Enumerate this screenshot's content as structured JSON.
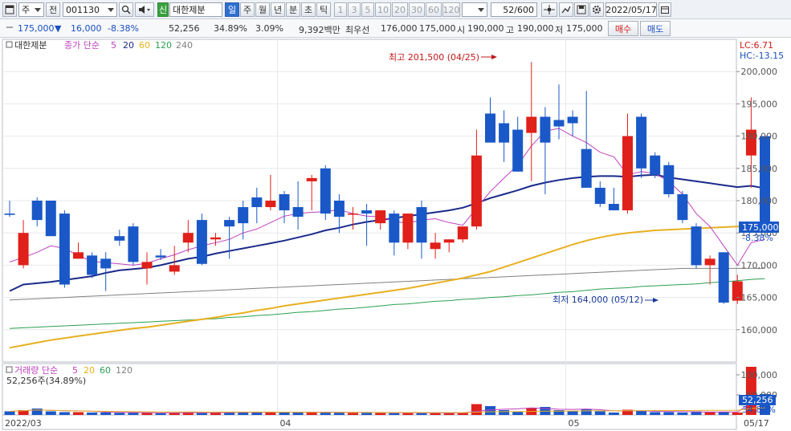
{
  "toolbar": {
    "type_select": "주",
    "prev_label": "전",
    "code": "001130",
    "market_badge": "신",
    "stock_name": "대한제분",
    "period_tabs": [
      "일",
      "주",
      "월",
      "년",
      "분",
      "초",
      "틱"
    ],
    "active_period": "일",
    "intervals": [
      "1",
      "3",
      "5",
      "10",
      "20",
      "30",
      "60",
      "120"
    ],
    "count": "52/600",
    "date": "2022/05/17"
  },
  "quote": {
    "price": "175,000",
    "change": "16,000",
    "change_pct": "-8.38%",
    "volume": "52,256",
    "vol_ratio": "34.89%",
    "turnover": "3.09%",
    "amount": "9,392백만",
    "best_ask_label": "최우선",
    "best_ask": "176,000",
    "best_bid": "175,000",
    "open_label": "시",
    "open": "190,000",
    "high_label": "고",
    "high": "190,000",
    "low_label": "저",
    "low": "175,000",
    "buy_label": "매수",
    "sell_label": "매도"
  },
  "legend": {
    "name": "대한제분",
    "ma_title": "종가 단순",
    "ma_periods": [
      "5",
      "20",
      "60",
      "120",
      "240"
    ],
    "ma_colors": [
      "#c040c0",
      "#1a2a8a",
      "#e8b020",
      "#2aa050",
      "#808080"
    ],
    "lc": "LC:6.71",
    "hc": "HC:-13.15"
  },
  "annotations": {
    "high_text": "최고 201,500 (04/25)",
    "low_text": "최저 164,000 (05/12)"
  },
  "price_axis": {
    "ticks": [
      "200,000",
      "195,000",
      "190,000",
      "185,000",
      "180,000",
      "175,000",
      "170,000",
      "165,000",
      "160,000"
    ],
    "current_label": "175,000",
    "current_change": "-8.38%"
  },
  "volume_panel": {
    "title": "거래량 단순",
    "ma_periods": [
      "5",
      "20",
      "60",
      "120"
    ],
    "ma_colors": [
      "#c040c0",
      "#e8b020",
      "#2aa050",
      "#808080"
    ],
    "current_text": "52,256주(34.89%)",
    "ticks": [
      "100,000",
      "50,000"
    ],
    "current_label": "52,256",
    "current_pct": "34.89%"
  },
  "date_axis": [
    "2022/03",
    "04",
    "05",
    "05/17"
  ],
  "colors": {
    "up": "#e0201a",
    "down": "#1a58c8",
    "ma5": "#c040c0",
    "ma20": "#1a2a8a",
    "ma60": "#e8b020",
    "ma120": "#2aa050",
    "ma240": "#808080"
  },
  "chart_data": {
    "type": "candlestick",
    "ylim": [
      155000,
      205000
    ],
    "vol_ylim": [
      0,
      120000
    ],
    "candles": [
      {
        "d": "03/01",
        "o": 178000,
        "h": 180000,
        "l": 177500,
        "c": 177800,
        "v": 9000
      },
      {
        "d": "03/02",
        "o": 170000,
        "h": 177000,
        "l": 169500,
        "c": 175000,
        "v": 12000
      },
      {
        "d": "03/03",
        "o": 180000,
        "h": 180500,
        "l": 176000,
        "c": 177000,
        "v": 16000
      },
      {
        "d": "03/04",
        "o": 180000,
        "h": 180000,
        "l": 176000,
        "c": 174500,
        "v": 9000
      },
      {
        "d": "03/07",
        "o": 178000,
        "h": 178500,
        "l": 166500,
        "c": 167000,
        "v": 7000
      },
      {
        "d": "03/08",
        "o": 171000,
        "h": 173500,
        "l": 171000,
        "c": 172000,
        "v": 7000
      },
      {
        "d": "03/10",
        "o": 171500,
        "h": 172000,
        "l": 168000,
        "c": 168500,
        "v": 6000
      },
      {
        "d": "03/11",
        "o": 171000,
        "h": 172000,
        "l": 166000,
        "c": 169500,
        "v": 6000
      },
      {
        "d": "03/14",
        "o": 174500,
        "h": 175500,
        "l": 173000,
        "c": 173800,
        "v": 5000
      },
      {
        "d": "03/15",
        "o": 176000,
        "h": 176500,
        "l": 170000,
        "c": 170500,
        "v": 6000
      },
      {
        "d": "03/16",
        "o": 169500,
        "h": 172000,
        "l": 167000,
        "c": 170500,
        "v": 5000
      },
      {
        "d": "03/17",
        "o": 171500,
        "h": 172500,
        "l": 170800,
        "c": 171200,
        "v": 4000
      },
      {
        "d": "03/18",
        "o": 169000,
        "h": 173000,
        "l": 168500,
        "c": 170000,
        "v": 5000
      },
      {
        "d": "03/21",
        "o": 173500,
        "h": 177000,
        "l": 172000,
        "c": 175000,
        "v": 8000
      },
      {
        "d": "03/22",
        "o": 177000,
        "h": 178000,
        "l": 170000,
        "c": 170200,
        "v": 6000
      },
      {
        "d": "03/23",
        "o": 174000,
        "h": 175000,
        "l": 173000,
        "c": 174300,
        "v": 5000
      },
      {
        "d": "03/24",
        "o": 177000,
        "h": 177500,
        "l": 171000,
        "c": 176000,
        "v": 6000
      },
      {
        "d": "03/25",
        "o": 179000,
        "h": 180000,
        "l": 174000,
        "c": 176500,
        "v": 7000
      },
      {
        "d": "03/28",
        "o": 180500,
        "h": 182000,
        "l": 176500,
        "c": 179000,
        "v": 8000
      },
      {
        "d": "03/29",
        "o": 179000,
        "h": 184000,
        "l": 178500,
        "c": 180000,
        "v": 7000
      },
      {
        "d": "03/30",
        "o": 181000,
        "h": 181500,
        "l": 176500,
        "c": 178500,
        "v": 6000
      },
      {
        "d": "03/31",
        "o": 179000,
        "h": 183000,
        "l": 175500,
        "c": 177500,
        "v": 6000
      },
      {
        "d": "04/01",
        "o": 183000,
        "h": 184000,
        "l": 178500,
        "c": 183500,
        "v": 8000
      },
      {
        "d": "04/04",
        "o": 185000,
        "h": 185500,
        "l": 177000,
        "c": 178000,
        "v": 8000
      },
      {
        "d": "04/05",
        "o": 180000,
        "h": 181000,
        "l": 175000,
        "c": 177500,
        "v": 6000
      },
      {
        "d": "04/06",
        "o": 178000,
        "h": 179000,
        "l": 175500,
        "c": 178000,
        "v": 5000
      },
      {
        "d": "04/07",
        "o": 178500,
        "h": 179500,
        "l": 173000,
        "c": 178000,
        "v": 5000
      },
      {
        "d": "04/08",
        "o": 176500,
        "h": 178500,
        "l": 175500,
        "c": 178500,
        "v": 5000
      },
      {
        "d": "04/11",
        "o": 178000,
        "h": 178500,
        "l": 171500,
        "c": 173500,
        "v": 5000
      },
      {
        "d": "04/12",
        "o": 173500,
        "h": 177500,
        "l": 172500,
        "c": 178000,
        "v": 6000
      },
      {
        "d": "04/13",
        "o": 179000,
        "h": 180000,
        "l": 171000,
        "c": 173500,
        "v": 5000
      },
      {
        "d": "04/14",
        "o": 172500,
        "h": 175000,
        "l": 171000,
        "c": 173500,
        "v": 4000
      },
      {
        "d": "04/15",
        "o": 173500,
        "h": 174000,
        "l": 172000,
        "c": 174000,
        "v": 4000
      },
      {
        "d": "04/18",
        "o": 174000,
        "h": 176000,
        "l": 173500,
        "c": 176000,
        "v": 6000
      },
      {
        "d": "04/19",
        "o": 176000,
        "h": 191000,
        "l": 175500,
        "c": 187000,
        "v": 27000
      },
      {
        "d": "04/20",
        "o": 193500,
        "h": 196000,
        "l": 189000,
        "c": 189000,
        "v": 22000
      },
      {
        "d": "04/21",
        "o": 192000,
        "h": 194000,
        "l": 186000,
        "c": 189000,
        "v": 12000
      },
      {
        "d": "04/22",
        "o": 191000,
        "h": 193000,
        "l": 184500,
        "c": 184500,
        "v": 9000
      },
      {
        "d": "04/25",
        "o": 190500,
        "h": 201500,
        "l": 183000,
        "c": 193000,
        "v": 18000
      },
      {
        "d": "04/26",
        "o": 193000,
        "h": 194500,
        "l": 181000,
        "c": 189000,
        "v": 20000
      },
      {
        "d": "04/27",
        "o": 192500,
        "h": 198000,
        "l": 189500,
        "c": 191500,
        "v": 12000
      },
      {
        "d": "04/28",
        "o": 193000,
        "h": 194000,
        "l": 190000,
        "c": 192000,
        "v": 10000
      },
      {
        "d": "04/29",
        "o": 188000,
        "h": 197000,
        "l": 182000,
        "c": 182000,
        "v": 14000
      },
      {
        "d": "05/02",
        "o": 182000,
        "h": 183000,
        "l": 179000,
        "c": 179500,
        "v": 9000
      },
      {
        "d": "05/03",
        "o": 179500,
        "h": 182000,
        "l": 178500,
        "c": 178500,
        "v": 6000
      },
      {
        "d": "05/04",
        "o": 178500,
        "h": 193500,
        "l": 178000,
        "c": 190000,
        "v": 13000
      },
      {
        "d": "05/06",
        "o": 193000,
        "h": 193500,
        "l": 183500,
        "c": 185000,
        "v": 10000
      },
      {
        "d": "05/09",
        "o": 187000,
        "h": 187500,
        "l": 183500,
        "c": 184000,
        "v": 7000
      },
      {
        "d": "05/10",
        "o": 185500,
        "h": 186000,
        "l": 180500,
        "c": 181000,
        "v": 7000
      },
      {
        "d": "05/11",
        "o": 181000,
        "h": 181500,
        "l": 176500,
        "c": 177000,
        "v": 6000
      },
      {
        "d": "05/12",
        "o": 176000,
        "h": 176500,
        "l": 169500,
        "c": 170000,
        "v": 9000
      },
      {
        "d": "05/13",
        "o": 170000,
        "h": 171500,
        "l": 167000,
        "c": 171000,
        "v": 7000
      },
      {
        "d": "05/16",
        "o": 172000,
        "h": 172000,
        "l": 164000,
        "c": 164200,
        "v": 8000
      },
      {
        "d": "05/17",
        "o": 164500,
        "h": 168500,
        "l": 164000,
        "c": 167500,
        "v": 6000
      },
      {
        "d": "05/18",
        "o": 187000,
        "h": 196000,
        "l": 182000,
        "c": 191000,
        "v": 120000
      },
      {
        "d": "05/19",
        "o": 190000,
        "h": 190000,
        "l": 175000,
        "c": 175000,
        "v": 52256
      }
    ],
    "ma5": [
      170500,
      171200,
      172000,
      173000,
      172600,
      171500,
      170600,
      170400,
      170200,
      170000,
      170300,
      171000,
      171600,
      172400,
      173000,
      173500,
      174000,
      175000,
      175600,
      176600,
      177600,
      178000,
      178200,
      178300,
      178600,
      178000,
      177600,
      177500,
      176800,
      176500,
      177000,
      177200,
      176600,
      176200,
      178800,
      181400,
      183500,
      185500,
      188500,
      190800,
      191200,
      190000,
      189000,
      187500,
      186800,
      184000,
      184500,
      184200,
      183000,
      181000,
      178000,
      176000,
      173000,
      170000,
      173500,
      174000
    ],
    "ma20": [
      166000,
      167000,
      167200,
      167400,
      167700,
      168000,
      168300,
      168800,
      169200,
      169400,
      169600,
      170000,
      170500,
      171000,
      171300,
      171800,
      172200,
      172600,
      173000,
      173400,
      173800,
      174300,
      174800,
      175400,
      175800,
      176300,
      176700,
      177000,
      177300,
      177600,
      177900,
      178200,
      178500,
      178900,
      179600,
      180400,
      181000,
      181600,
      182300,
      182800,
      183200,
      183500,
      183700,
      183800,
      183800,
      183700,
      183900,
      184000,
      183600,
      183300,
      183000,
      182700,
      182400,
      182100,
      182300,
      181900
    ],
    "ma60": [
      157200,
      157600,
      158000,
      158400,
      158700,
      159000,
      159300,
      159600,
      159900,
      160200,
      160400,
      160700,
      161000,
      161300,
      161600,
      161900,
      162300,
      162600,
      163000,
      163300,
      163700,
      164000,
      164300,
      164600,
      164900,
      165200,
      165500,
      165800,
      166100,
      166400,
      166800,
      167200,
      167600,
      168000,
      168500,
      169000,
      169700,
      170400,
      171100,
      171800,
      172500,
      173200,
      173800,
      174300,
      174700,
      175000,
      175200,
      175400,
      175500,
      175600,
      175700,
      175800,
      175900,
      176000,
      176100,
      176300
    ],
    "ma120": [
      160200,
      160300,
      160400,
      160500,
      160600,
      160700,
      160800,
      160900,
      161000,
      161100,
      161200,
      161300,
      161400,
      161500,
      161600,
      161700,
      161900,
      162000,
      162200,
      162300,
      162500,
      162700,
      162800,
      163000,
      163200,
      163300,
      163500,
      163700,
      163900,
      164000,
      164200,
      164400,
      164500,
      164700,
      164800,
      165000,
      165100,
      165300,
      165400,
      165600,
      165800,
      165900,
      166100,
      166300,
      166400,
      166500,
      166700,
      166800,
      166900,
      167000,
      167100,
      167300,
      167400,
      167600,
      167800,
      167900
    ],
    "ma240": [
      164600,
      164700,
      164800,
      164900,
      165000,
      165100,
      165200,
      165300,
      165400,
      165500,
      165600,
      165700,
      165800,
      165900,
      166000,
      166100,
      166200,
      166300,
      166400,
      166500,
      166600,
      166700,
      166800,
      166900,
      167000,
      167100,
      167200,
      167300,
      167400,
      167500,
      167600,
      167700,
      167800,
      167900,
      168000,
      168100,
      168200,
      168300,
      168400,
      168500,
      168600,
      168700,
      168800,
      168900,
      169000,
      169100,
      169200,
      169300,
      169400,
      169500,
      169500,
      169500,
      169500,
      169500,
      169500,
      169500
    ]
  }
}
